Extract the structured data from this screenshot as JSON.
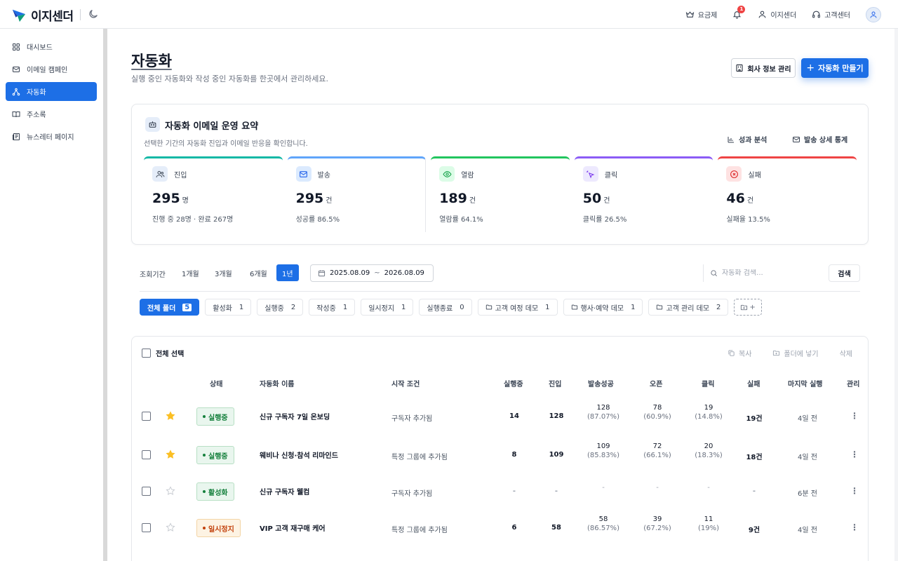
{
  "app": {
    "logo_text": "이지센더",
    "top_links": {
      "pricing": "요금제",
      "account": "이지센더",
      "support": "고객센터"
    },
    "notification_count": "1"
  },
  "sidebar": {
    "items": [
      {
        "label": "대시보드",
        "icon": "grid-icon"
      },
      {
        "label": "이메일 캠페인",
        "icon": "mail-icon"
      },
      {
        "label": "자동화",
        "icon": "workflow-icon"
      },
      {
        "label": "주소록",
        "icon": "book-icon"
      },
      {
        "label": "뉴스레터 페이지",
        "icon": "newspaper-icon"
      }
    ],
    "active_index": 2
  },
  "header": {
    "title": "자동화",
    "subtitle": "실행 중인 자동화와 작성 중인 자동화를 한곳에서 관리하세요.",
    "company_button": "회사 정보 관리",
    "create_button": "자동화 만들기"
  },
  "summary": {
    "title": "자동화 이메일 운영 요약",
    "subtitle": "선택한 기간의 자동화 진입과 이메일 반응을 확인합니다.",
    "link_performance": "성과 분석",
    "link_stats": "발송 상세 통계",
    "kpis": [
      {
        "label": "진입",
        "value": "295",
        "unit": "명",
        "note": "진행 중 28명 · 완료 267명",
        "color": "#14b8a6",
        "icon_bg": "#e5edf9",
        "icon_color": "#4b5563",
        "icon": "users-icon"
      },
      {
        "label": "발송",
        "value": "295",
        "unit": "건",
        "note": "성공률 86.5%",
        "color": "#60a5fa",
        "icon_bg": "#dbeafe",
        "icon_color": "#2563eb",
        "icon": "mail-icon"
      },
      {
        "label": "열람",
        "value": "189",
        "unit": "건",
        "note": "열람률 64.1%",
        "color": "#22c55e",
        "icon_bg": "#dcfce7",
        "icon_color": "#16a34a",
        "icon": "eye-icon"
      },
      {
        "label": "클릭",
        "value": "50",
        "unit": "건",
        "note": "클릭률 26.5%",
        "color": "#8b5cf6",
        "icon_bg": "#ede9fe",
        "icon_color": "#7c3aed",
        "icon": "pointer-icon"
      },
      {
        "label": "실패",
        "value": "46",
        "unit": "건",
        "note": "실패율 13.5%",
        "color": "#ef4444",
        "icon_bg": "#fee2e2",
        "icon_color": "#dc2626",
        "icon": "x-circle-icon"
      }
    ]
  },
  "filters": {
    "period_label": "조회기간",
    "periods": [
      "1개월",
      "3개월",
      "6개월",
      "1년"
    ],
    "active_period": 3,
    "date_from": "2025.08.09",
    "date_sep": "~",
    "date_to": "2026.08.09",
    "search_placeholder": "자동화 검색...",
    "search_button": "검색",
    "chips": [
      {
        "label": "전체 폴더",
        "count": "5",
        "active": true,
        "folder": false
      },
      {
        "label": "활성화",
        "count": "1",
        "folder": false
      },
      {
        "label": "실행중",
        "count": "2",
        "folder": false
      },
      {
        "label": "작성중",
        "count": "1",
        "folder": false
      },
      {
        "label": "일시정지",
        "count": "1",
        "folder": false
      },
      {
        "label": "실행종료",
        "count": "0",
        "folder": false
      },
      {
        "label": "고객 여정 데모",
        "count": "1",
        "folder": true
      },
      {
        "label": "행사·예약 데모",
        "count": "1",
        "folder": true
      },
      {
        "label": "고객 관리 데모",
        "count": "2",
        "folder": true
      }
    ],
    "add_folder_label": "+"
  },
  "table": {
    "select_all": "전체 선택",
    "actions": {
      "copy": "복사",
      "move": "폴더에 넣기",
      "delete": "삭제"
    },
    "columns": {
      "status": "상태",
      "name": "자동화 이름",
      "trigger": "시작 조건",
      "running": "실행중",
      "entered": "진입",
      "sent": "발송성공",
      "open": "오픈",
      "click": "클릭",
      "fail": "실패",
      "last_run": "마지막 실행",
      "manage": "관리"
    },
    "rows": [
      {
        "starred": true,
        "status": "실행중",
        "status_type": "run",
        "name": "신규 구독자 7일 온보딩",
        "trigger": "구독자 추가됨",
        "running": "14",
        "entered": "128",
        "sent": "128",
        "sent_pct": "(87.07%)",
        "open": "78",
        "open_pct": "(60.9%)",
        "click": "19",
        "click_pct": "(14.8%)",
        "fail": "19건",
        "last_run": "4일 전"
      },
      {
        "starred": true,
        "status": "실행중",
        "status_type": "run",
        "name": "웨비나 신청·참석 리마인드",
        "trigger": "특정 그룹에 추가됨",
        "running": "8",
        "entered": "109",
        "sent": "109",
        "sent_pct": "(85.83%)",
        "open": "72",
        "open_pct": "(66.1%)",
        "click": "20",
        "click_pct": "(18.3%)",
        "fail": "18건",
        "last_run": "4일 전"
      },
      {
        "starred": false,
        "status": "활성화",
        "status_type": "run",
        "name": "신규 구독자 웰컴",
        "trigger": "구독자 추가됨",
        "running": "-",
        "entered": "-",
        "sent": "-",
        "sent_pct": "",
        "open": "-",
        "open_pct": "",
        "click": "-",
        "click_pct": "",
        "fail": "-",
        "last_run": "6분 전"
      },
      {
        "starred": false,
        "status": "일시정지",
        "status_type": "pause",
        "name": "VIP 고객 재구매 케어",
        "trigger": "특정 그룹에 추가됨",
        "running": "6",
        "entered": "58",
        "sent": "58",
        "sent_pct": "(86.57%)",
        "open": "39",
        "open_pct": "(67.2%)",
        "click": "11",
        "click_pct": "(19%)",
        "fail": "9건",
        "last_run": "4일 전"
      }
    ]
  }
}
